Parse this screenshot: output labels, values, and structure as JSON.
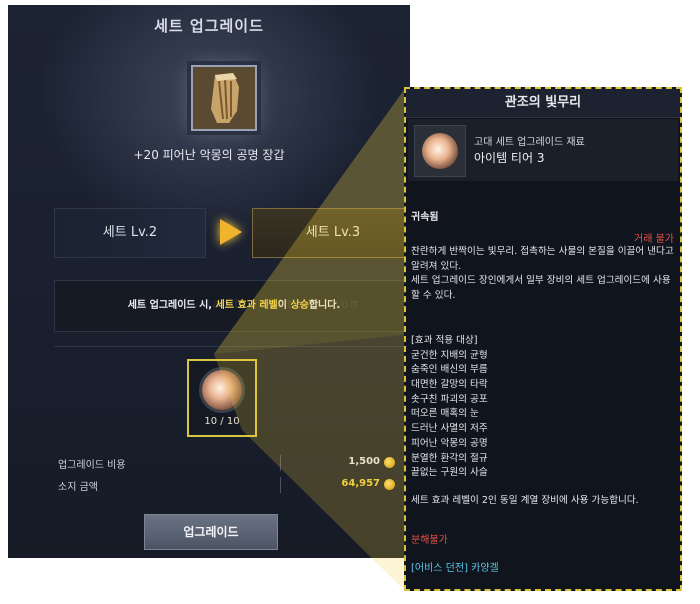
{
  "panel": {
    "title": "세트 업그레이드",
    "item_name": "+20 피어난 악몽의 공명 장갑",
    "level_from": "세트 Lv.2",
    "level_to": "세트 Lv.3",
    "notice_prefix": "세트 업그레이드 시, ",
    "notice_highlight1": "세트 효과 레벨",
    "notice_mid": "이 ",
    "notice_highlight2": "상승",
    "notice_suffix": "합니다.",
    "material_count": "10 / 10",
    "cost_label": "업그레이드 비용",
    "cost_value": "1,500",
    "money_label": "소지 금액",
    "money_value": "64,957",
    "upgrade_button": "업그레이드",
    "watermark": "mandy.tistory.com"
  },
  "tooltip": {
    "title": "관조의 빛무리",
    "category": "고대 세트 업그레이드 재료",
    "tier": "아이템 티어 3",
    "bound": "귀속됨",
    "trade": "거래 불가",
    "desc": "찬란하게 반짝이는 빛무리. 접촉하는 사물의 본질을 이끌어 낸다고 알려져 있다.\n세트 업그레이드 장인에게서 일부 장비의 세트 업그레이드에 사용할 수 있다.",
    "list_header": "[효과 적용 대상]",
    "list": [
      "굳건한 지배의 균형",
      "숨죽인 배신의 부름",
      "대면한 갈망의 타락",
      "솟구친 파괴의 공포",
      "떠오른 매혹의 눈",
      "드러난 사멸의 저주",
      "피어난 악몽의 공명",
      "분열한 환각의 절규",
      "끝없는 구원의 사슬"
    ],
    "note": "세트 효과 레벨이 2인 동일 계열 장비에 사용 가능합니다.",
    "no_decompose": "분해불가",
    "source": "[어비스 던전] 카양겔"
  },
  "colors": {
    "highlight": "#f3d34a",
    "warning": "#e5514a",
    "source": "#5cc6e6",
    "frame": "#d9c23d"
  }
}
